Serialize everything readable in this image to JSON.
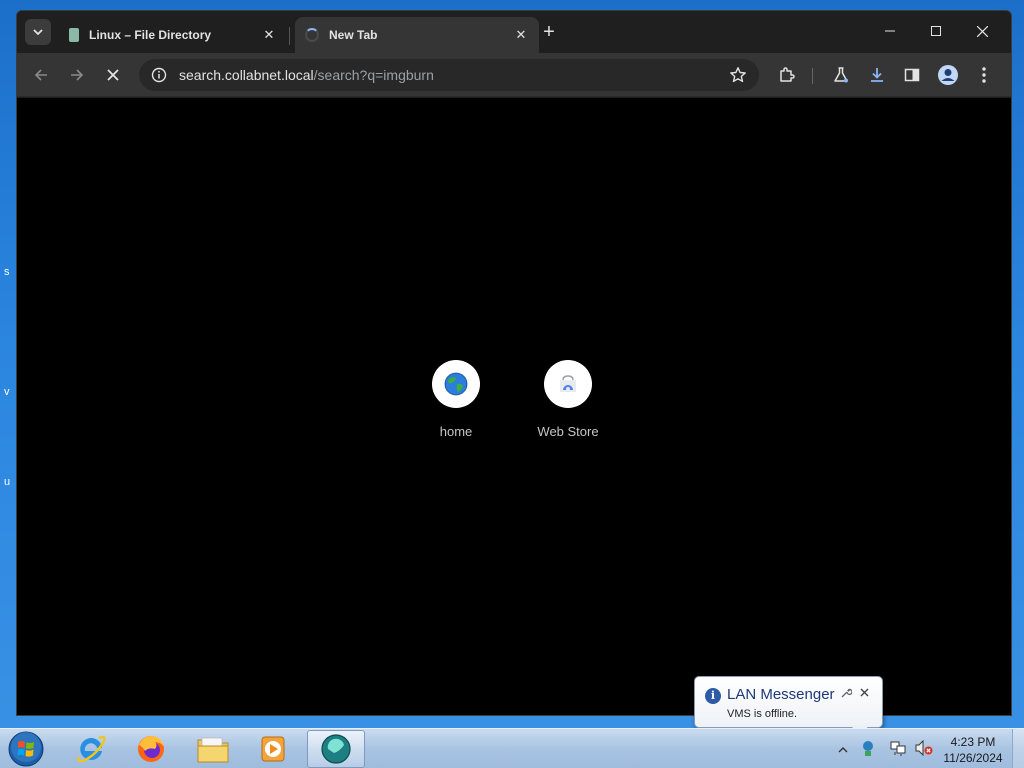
{
  "browser": {
    "tabs": [
      {
        "title": "Linux – File Directory",
        "close": "✕",
        "active": false
      },
      {
        "title": "New Tab",
        "close": "✕",
        "active": true
      }
    ],
    "new_tab": "+",
    "address": {
      "host": "search.collabnet.local",
      "path": "/search?q=imgburn"
    }
  },
  "content": {
    "shortcuts": [
      {
        "label": "home",
        "icon": "globe-icon"
      },
      {
        "label": "Web Store",
        "icon": "web-store-icon"
      }
    ]
  },
  "taskbar": {
    "apps": [
      {
        "name": "internet-explorer-icon"
      },
      {
        "name": "firefox-icon"
      },
      {
        "name": "file-explorer-icon"
      },
      {
        "name": "media-player-icon"
      },
      {
        "name": "lan-messenger-icon"
      }
    ],
    "clock": {
      "time": "4:23 PM",
      "date": "11/26/2024"
    }
  },
  "notification": {
    "title": "LAN Messenger",
    "text": "VMS is offline."
  },
  "colors": {
    "accent": "#8ab4f8",
    "browser_bg": "#1f1f1f",
    "toolbar_bg": "#353535"
  }
}
